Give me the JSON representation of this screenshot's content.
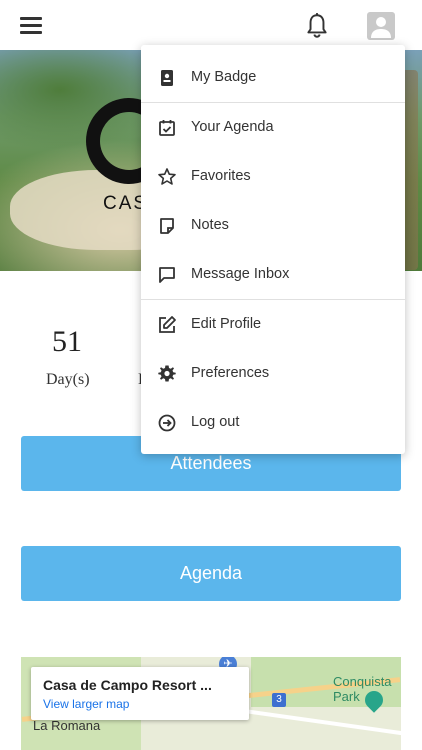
{
  "header": {
    "menu_icon": "hamburger-icon",
    "notification_icon": "bell-icon",
    "avatar_icon": "user-avatar"
  },
  "hero": {
    "brand_text": "CAS"
  },
  "countdown": {
    "days_value": "51",
    "days_label": "Day(s)",
    "second_label_partial": "H"
  },
  "buttons": {
    "attendees": "Attendees",
    "agenda": "Agenda"
  },
  "map": {
    "place_title": "Casa de Campo Resort ...",
    "view_larger": "View larger map",
    "park_label": "Conquista Park",
    "town_label": "La Romana",
    "highway_number": "3"
  },
  "menu": {
    "items": [
      {
        "label": "My Badge",
        "icon": "badge-icon"
      },
      {
        "label": "Your Agenda",
        "icon": "calendar-check-icon"
      },
      {
        "label": "Favorites",
        "icon": "star-icon"
      },
      {
        "label": "Notes",
        "icon": "note-icon"
      },
      {
        "label": "Message Inbox",
        "icon": "message-icon"
      },
      {
        "label": "Edit Profile",
        "icon": "edit-icon"
      },
      {
        "label": "Preferences",
        "icon": "gear-icon"
      },
      {
        "label": "Log out",
        "icon": "logout-icon"
      }
    ]
  },
  "colors": {
    "button_bg": "#5bb6ec",
    "link": "#1a73e8"
  }
}
